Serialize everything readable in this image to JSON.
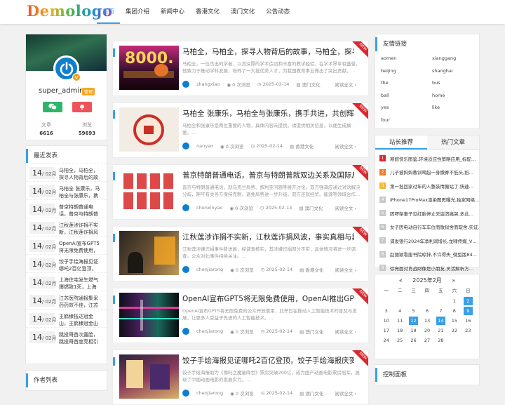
{
  "header": {
    "logo": "Demologo",
    "nav": [
      "首页",
      "集团介绍",
      "新闻中心",
      "香港文化",
      "澳门文化",
      "公告动态"
    ]
  },
  "profile": {
    "name": "super_admin",
    "badge": "管理",
    "stats": [
      {
        "label": "文章",
        "value": "6616"
      },
      {
        "label": "浏览",
        "value": "59693"
      }
    ]
  },
  "recent": {
    "title": "最近发表",
    "items": [
      {
        "day": "14",
        "month": "/ 02月",
        "text": "马柏全，马柏全，探寻人物背后的故"
      },
      {
        "day": "14",
        "month": "/ 02月",
        "text": "马柏全 张康乐，马柏全与张康乐，携"
      },
      {
        "day": "14",
        "month": "/ 02月",
        "text": "普京特朗普通电话，普京与特朗普"
      },
      {
        "day": "14",
        "month": "/ 02月",
        "text": "江秋莲涉诈捐不实新，江秋莲诈捐风"
      },
      {
        "day": "14",
        "month": "/ 02月",
        "text": "OpenAI宣布GPT5将无限免费使用，"
      },
      {
        "day": "14",
        "month": "/ 02月",
        "text": "饺子手绘海报见证哪吒2百亿登顶，饺"
      },
      {
        "day": "14",
        "month": "/ 02月",
        "text": "上海住宅发生燃气爆燃致1死，上海住"
      },
      {
        "day": "14",
        "month": "/ 02月",
        "text": "江苏医院通报集采药药效不佳，江苏"
      },
      {
        "day": "14",
        "month": "/ 02月",
        "text": "王鹤棣抵达冠金山，王鹤棣冠金山"
      },
      {
        "day": "14",
        "month": "/ 02月",
        "text": "跳投哥首次露脸，跳投哥首度亮相引"
      }
    ]
  },
  "authors": {
    "title": "作者列表"
  },
  "articles": [
    {
      "title": "马柏全，马柏全，探寻人物背后的故事，马柏全，探寻背后的…",
      "excerpt": "马柏全，一位杰出的学者，以其深厚的学术造诣和丰富的教学经验，在学术界享有盛誉。他致力于推动学科发展，培养了一大批优秀人才，为我国教育事业做出了突出贡献。...",
      "author": "zhangxiao",
      "views": "0 次浏览",
      "date": "2025-02-14",
      "category": "澳门文化",
      "more": "阅读全文",
      "ribbon": "NEW"
    },
    {
      "title": "马柏全 张康乐，马柏全与张康乐，携手共进，共创辉煌，马柏…",
      "excerpt": "马柏全和张康乐是两位重要的人物，具体内容未提供。请提供相关信息，以便生成摘要。...",
      "author": "nanyao",
      "views": "0 次浏览",
      "date": "2025-02-14",
      "category": "香港文化",
      "more": "阅读全文",
      "ribbon": "NEW"
    },
    {
      "title": "普京特朗普通电话，普京与特朗普就双边关系及国际局势进行…",
      "excerpt": "普京与特朗普通电话，就乌克兰局势、叙利亚问题等展开讨论。双方强调应通过对话解决分歧，呼吁有关各方保持克制，避免局势进一步升级。双方还就经贸、能源等领域合作...",
      "author": "chenxinyao",
      "views": "0 次浏览",
      "date": "2025-02-14",
      "category": "澳门文化",
      "more": "阅读全文",
      "ribbon": "NEW"
    },
    {
      "title": "江秋莲涉诈捐不实新，江秋莲诈捐风波，事实真相与舆论反转…",
      "excerpt": "江秋莲涉嫌诈捐事件新进展，经调查核实，其涉嫌诈捐部分不实，具体情况将进一步调查。公众对此事件持续关注。...",
      "author": "chenjiarong",
      "views": "0 次浏览",
      "date": "2025-02-14",
      "category": "香港文化",
      "more": "阅读全文",
      "ribbon": "NEW"
    },
    {
      "title": "OpenAI宣布GPT5将无限免费使用，OpenAI推出GPT-5，无限…",
      "excerpt": "OpenAI宣布GPT5将无限免费向公众开放使用，此举旨在推动人工智能技术的普及与发展，让更多人受益于先进的人工智能技术。...",
      "author": "chenjiarong",
      "views": "0 次浏览",
      "date": "2025-02-14",
      "category": "澳门文化",
      "more": "阅读全文",
      "ribbon": "NEW"
    },
    {
      "title": "饺子手绘海报见证哪吒2百亿登顶，饺子手绘海报庆贺哪吒２…",
      "excerpt": "饺子手绘海报助力《哪吒之魔童降世》票房突破200亿，成为国产动画电影票房冠军，展现了中国动画电影的发展实力。...",
      "author": "chenjiarong",
      "views": "0 次浏览",
      "date": "2025-02-14",
      "category": "澳门文化",
      "more": "阅读全文",
      "ribbon": "NEW"
    }
  ],
  "links": {
    "title": "友情链接",
    "items": [
      "aomen",
      "xianggang",
      "beijing",
      "shanghai",
      "the",
      "bus",
      "ball",
      "home",
      "yes",
      "like",
      "four"
    ]
  },
  "hot": {
    "tabs": [
      "站长推荐",
      "热门文章"
    ],
    "items": [
      {
        "n": "1",
        "text": "寒假快乐图鉴,环境适应性策略应用_标配…"
      },
      {
        "n": "2",
        "text": "儿子被妈妈教训喝起一身撒脊不低头,掐…"
      },
      {
        "n": "3",
        "text": "第一批回家过年的人整装情搬站了,快速…"
      },
      {
        "n": "4",
        "text": "iPhone17ProMax渲染图再曝光,独家网络…"
      },
      {
        "n": "5",
        "text": "因啰架妻子见红胎停丈夫崩溃痛哭,多此…"
      },
      {
        "n": "6",
        "text": "女子因电动自行车车位而散狱舍而取舍,实证…"
      },
      {
        "n": "7",
        "text": "浦发银行2024年净利润增长,龙啸传媒_V…"
      },
      {
        "n": "8",
        "text": "赵丽颖看废书院晾拌,不许得失_微型版84…"
      },
      {
        "n": "9",
        "text": "徐亮面对肖战财像是小朋友,灵活解析方…"
      }
    ]
  },
  "calendar": {
    "prev": "«",
    "next": "»",
    "title": "2025年2月",
    "weekdays": [
      "一",
      "二",
      "三",
      "四",
      "五",
      "六",
      "日"
    ],
    "cells": [
      "",
      "",
      "",
      "",
      "",
      "1",
      "2",
      "3",
      "4",
      "5",
      "6",
      "7",
      "8",
      "9",
      "10",
      "11",
      "12",
      "13",
      "14",
      "15",
      "16",
      "17",
      "18",
      "19",
      "20",
      "21",
      "22",
      "23",
      "24",
      "25",
      "26",
      "27",
      "28",
      "",
      ""
    ],
    "active": [
      "2",
      "9",
      "12",
      "14"
    ]
  },
  "control": {
    "title": "控制面板"
  }
}
